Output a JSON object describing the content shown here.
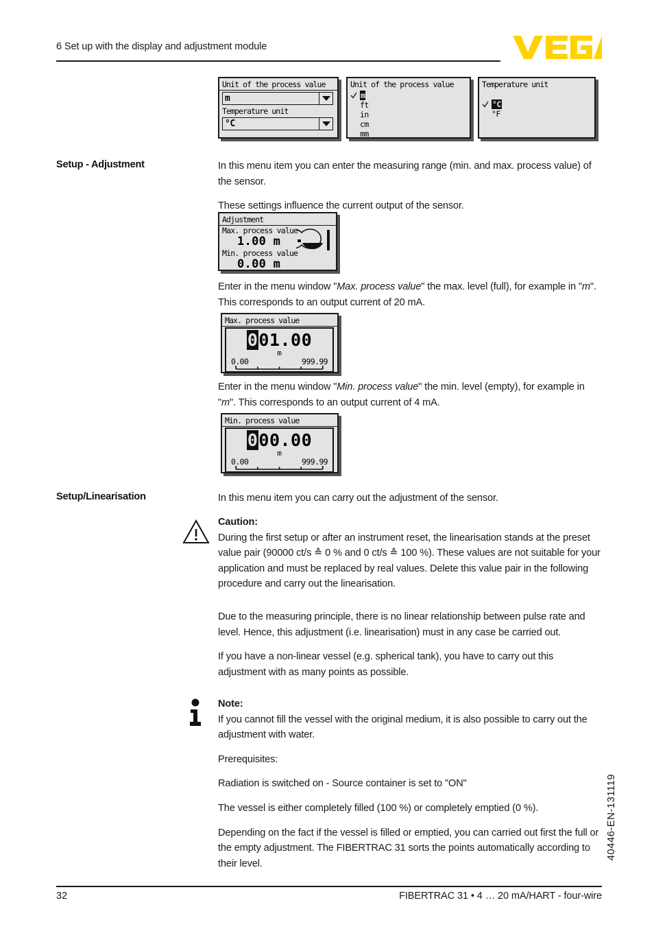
{
  "header": {
    "chapter_title": "6 Set up with the display and adjustment module",
    "logo_text": "VEGA",
    "logo_color": "#FFD200"
  },
  "screens": {
    "unit_dropdown": {
      "title": "Unit of the process value",
      "process_value_selected": "m",
      "temperature_label": "Temperature unit",
      "temperature_selected": "°C"
    },
    "unit_list": {
      "title": "Unit of the process value",
      "options": [
        "m",
        "ft",
        "in",
        "cm",
        "mm"
      ],
      "selected": "m",
      "more_indicator": "▼"
    },
    "temperature_list": {
      "title": "Temperature unit",
      "options": [
        "°C",
        "°F"
      ],
      "selected": "°C"
    },
    "adjustment": {
      "title": "Adjustment",
      "max_label": "Max. process value",
      "max_value": "1.00 m",
      "min_label": "Min. process value",
      "min_value": "0.00 m"
    },
    "max_entry": {
      "title": "Max. process value",
      "cursor_digit": "0",
      "remaining_digits": "01.00",
      "unit": "m",
      "range_min": "0.00",
      "range_max": "999.99"
    },
    "min_entry": {
      "title": "Min. process value",
      "cursor_digit": "0",
      "remaining_digits": "00.00",
      "unit": "m",
      "range_min": "0.00",
      "range_max": "999.99"
    }
  },
  "sections": {
    "setup_adjustment": {
      "label": "Setup - Adjustment",
      "para1": "In this menu item you can enter the measuring range (min. and max. process value) of the sensor.",
      "para2": "These settings influence the current output of the sensor.",
      "max_para_pre": "Enter in the menu window \"",
      "max_para_em1": "Max. process value",
      "max_para_mid": "\" the max. level (full), for example in \"",
      "max_para_em2": "m",
      "max_para_post": "\". This corresponds to an output current of 20 mA.",
      "min_para_pre": "Enter in the menu window \"",
      "min_para_em1": "Min. process value",
      "min_para_mid": "\" the min. level (empty), for example in \"",
      "min_para_em2": "m",
      "min_para_post": "\". This corresponds to an output current of 4 mA."
    },
    "setup_linearisation": {
      "label": "Setup/Linearisation",
      "intro": "In this menu item you can carry out the adjustment of the sensor.",
      "caution_title": "Caution:",
      "caution_body": "During the first setup or after an instrument reset, the linearisation stands at the preset value pair (90000 ct/s ≙ 0 % and 0 ct/s ≙ 100 %). These values are not suitable for your application and must be replaced by real values. Delete this value pair in the following procedure and carry out the linearisation.",
      "para_principle": "Due to the measuring principle, there is no linear relationship between pulse rate and level. Hence, this adjustment (i.e. linearisation) must in any case be carried out.",
      "para_nonlinear": "If you have a non-linear vessel (e.g. spherical tank), you have to carry out this adjustment with as many points as possible.",
      "note_title": "Note:",
      "note_body": "If you cannot fill the vessel with the original medium, it is also possible to carry out the adjustment with water.",
      "prerequisites_label": "Prerequisites:",
      "prereq_radiation": "Radiation is switched on - Source container is set to \"ON\"",
      "prereq_vessel": "The vessel is either completely filled (100 %) or completely emptied (0 %).",
      "para_depending": "Depending on the fact if the vessel is filled or emptied, you can carried out first the full or the empty adjustment. The FIBERTRAC 31 sorts the points automatically according to their level."
    }
  },
  "side_code": "40446-EN-131119",
  "footer": {
    "page_number": "32",
    "document_title": "FIBERTRAC 31 • 4 … 20 mA/HART - four-wire"
  }
}
